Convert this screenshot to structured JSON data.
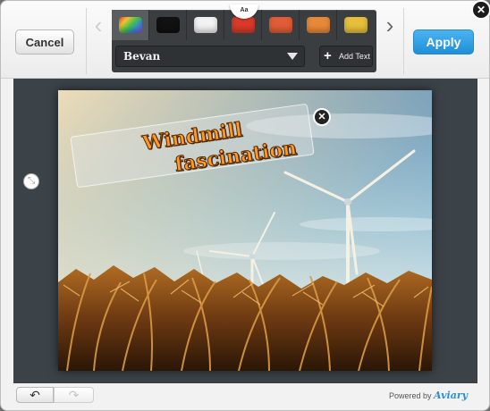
{
  "toolbar": {
    "cancel_label": "Cancel",
    "apply_label": "Apply",
    "prev_icon": "chevron-left-icon",
    "next_icon": "chevron-right-icon",
    "close_icon": "close-icon"
  },
  "panel": {
    "tab_label": "Aa",
    "swatches": [
      {
        "name": "rainbow",
        "color": "linear-gradient(135deg,#e64545,#f2c230,#46c24e,#3b82e0,#b045c7)"
      },
      {
        "name": "black",
        "color": "#111111"
      },
      {
        "name": "white",
        "color": "#f2f2f2"
      },
      {
        "name": "red",
        "color": "#d93a2b"
      },
      {
        "name": "orange-red",
        "color": "#e25c36"
      },
      {
        "name": "orange",
        "color": "#e8893a"
      },
      {
        "name": "yellow",
        "color": "#e6c03c"
      }
    ],
    "selected_swatch": "rainbow",
    "font_select_value": "Bevan",
    "add_text_label": "Add Text",
    "add_text_icon": "plus-icon"
  },
  "canvas": {
    "overlay_line_1": "Windmill",
    "overlay_line_2": "fascination",
    "overlay_text_color": "#ff9a1f",
    "overlay_close_icon": "close-icon",
    "overlay_resize_icon": "resize-handle-icon"
  },
  "footer": {
    "undo_icon": "undo-icon",
    "redo_icon": "redo-icon",
    "powered_by": "Powered by",
    "brand": "Aviary"
  },
  "colors": {
    "apply_blue": "#1e8fd8",
    "workspace_bg": "#3b4248",
    "panel_bg": "#3b3e41"
  }
}
